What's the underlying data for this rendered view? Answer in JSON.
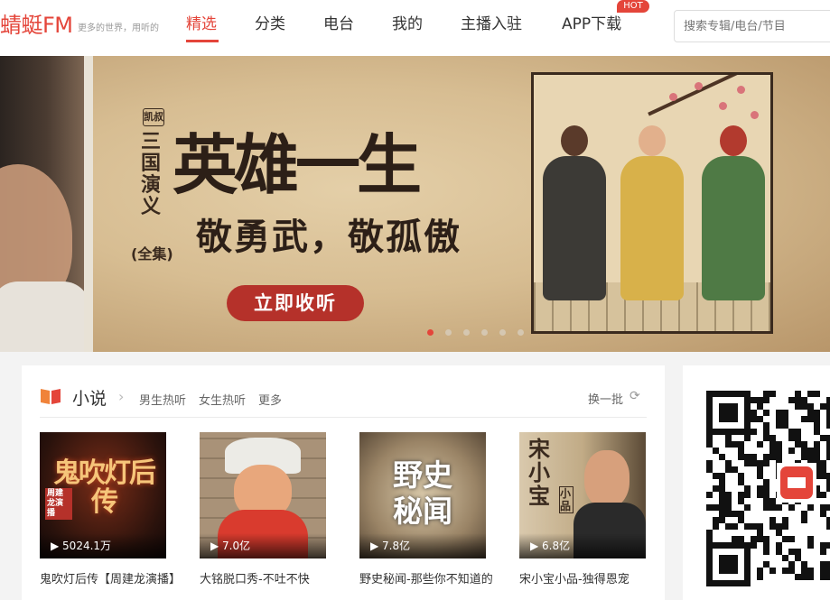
{
  "header": {
    "logo": "蜻蜓FM",
    "slogan": "更多的世界，用听的",
    "nav": [
      "精选",
      "分类",
      "电台",
      "我的",
      "主播入驻",
      "APP下载"
    ],
    "hot_badge": "HOT",
    "search_placeholder": "搜索专辑/电台/节目"
  },
  "banner": {
    "tag": "凯叔",
    "vertical_title": "三国演义",
    "suffix": "(全集)",
    "title": "英雄一生",
    "subtitle": "敬勇武，敬孤傲",
    "cta": "立即收听",
    "dots": 6,
    "active_dot": 0
  },
  "section": {
    "title": "小说",
    "links": [
      "男生热听",
      "女生热听",
      "更多"
    ],
    "refresh": "换一批",
    "items": [
      {
        "cover_text": "鬼吹灯后传",
        "cover_badge": "周建龙演播",
        "plays": "5024.1万",
        "title": "鬼吹灯后传【周建龙演播】"
      },
      {
        "cover_text": "",
        "plays": "7.0亿",
        "title": "大铭脱口秀-不吐不快"
      },
      {
        "cover_text": "野史秘闻",
        "plays": "7.8亿",
        "title": "野史秘闻-那些你不知道的"
      },
      {
        "cover_text": "宋小宝",
        "cover_badge": "小品",
        "plays": "6.8亿",
        "title": "宋小宝小品-独得恩宠"
      }
    ]
  },
  "colors": {
    "brand": "#e4453a",
    "text": "#333333",
    "muted": "#999999"
  }
}
